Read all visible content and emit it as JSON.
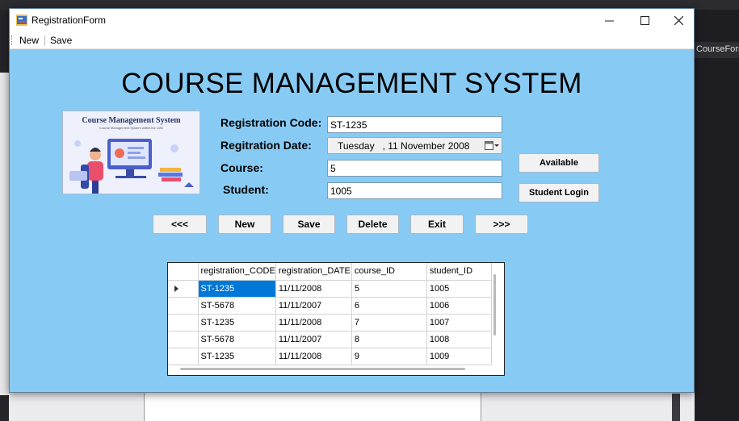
{
  "window": {
    "title": "RegistrationForm",
    "menu": {
      "new_label": "New",
      "save_label": "Save"
    }
  },
  "ide": {
    "right_tab_label": "CourseForm"
  },
  "heading": "COURSE MANAGEMENT SYSTEM",
  "logo": {
    "title": "Course Management System",
    "subtitle": "Course Management System within the LMS"
  },
  "form": {
    "registration_code": {
      "label": "Registration Code:",
      "value": "ST-1235"
    },
    "registration_date": {
      "label": "Regitration Date:",
      "value": "Tuesday   , 11 November 2008"
    },
    "course": {
      "label": "Course:",
      "value": "5"
    },
    "student": {
      "label": "Student:",
      "value": "1005"
    }
  },
  "side_buttons": {
    "available": "Available",
    "student_login": "Student Login"
  },
  "nav_buttons": {
    "prev": "<<<",
    "new": "New",
    "save": "Save",
    "delete": "Delete",
    "exit": "Exit",
    "next": ">>>"
  },
  "grid": {
    "columns": [
      "registration_CODE",
      "registration_DATE",
      "course_ID",
      "student_ID"
    ],
    "rows": [
      [
        "ST-1235",
        "11/11/2008",
        "5",
        "1005"
      ],
      [
        "ST-5678",
        "11/11/2007",
        "6",
        "1006"
      ],
      [
        "ST-1235",
        "11/11/2008",
        "7",
        "1007"
      ],
      [
        "ST-5678",
        "11/11/2007",
        "8",
        "1008"
      ],
      [
        "ST-1235",
        "11/11/2008",
        "9",
        "1009"
      ]
    ]
  },
  "colors": {
    "form_background": "#87cbf5",
    "selection": "#0078d7"
  }
}
